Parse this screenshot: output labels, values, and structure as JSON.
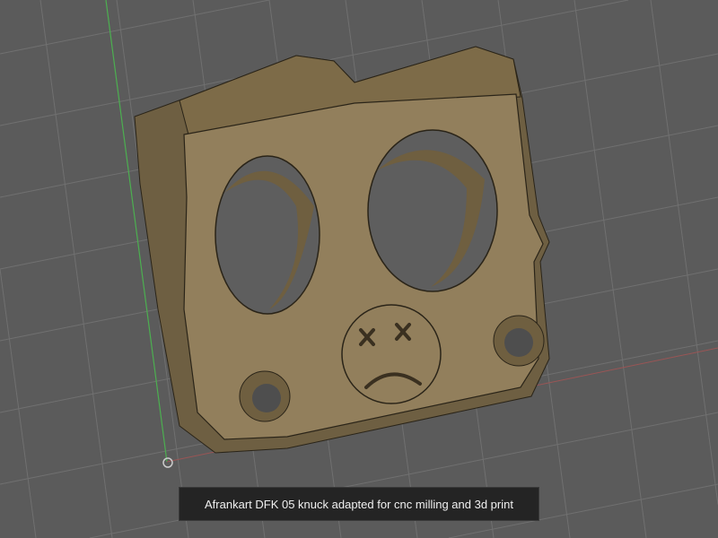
{
  "caption": "Afrankart DFK 05 knuck adapted for cnc milling and 3d print",
  "colors": {
    "background": "#5b5b5b",
    "grid": "#6f6f6f",
    "model": "#8c7a58",
    "axis_y": "#4caf50",
    "axis_x": "#a05050"
  }
}
